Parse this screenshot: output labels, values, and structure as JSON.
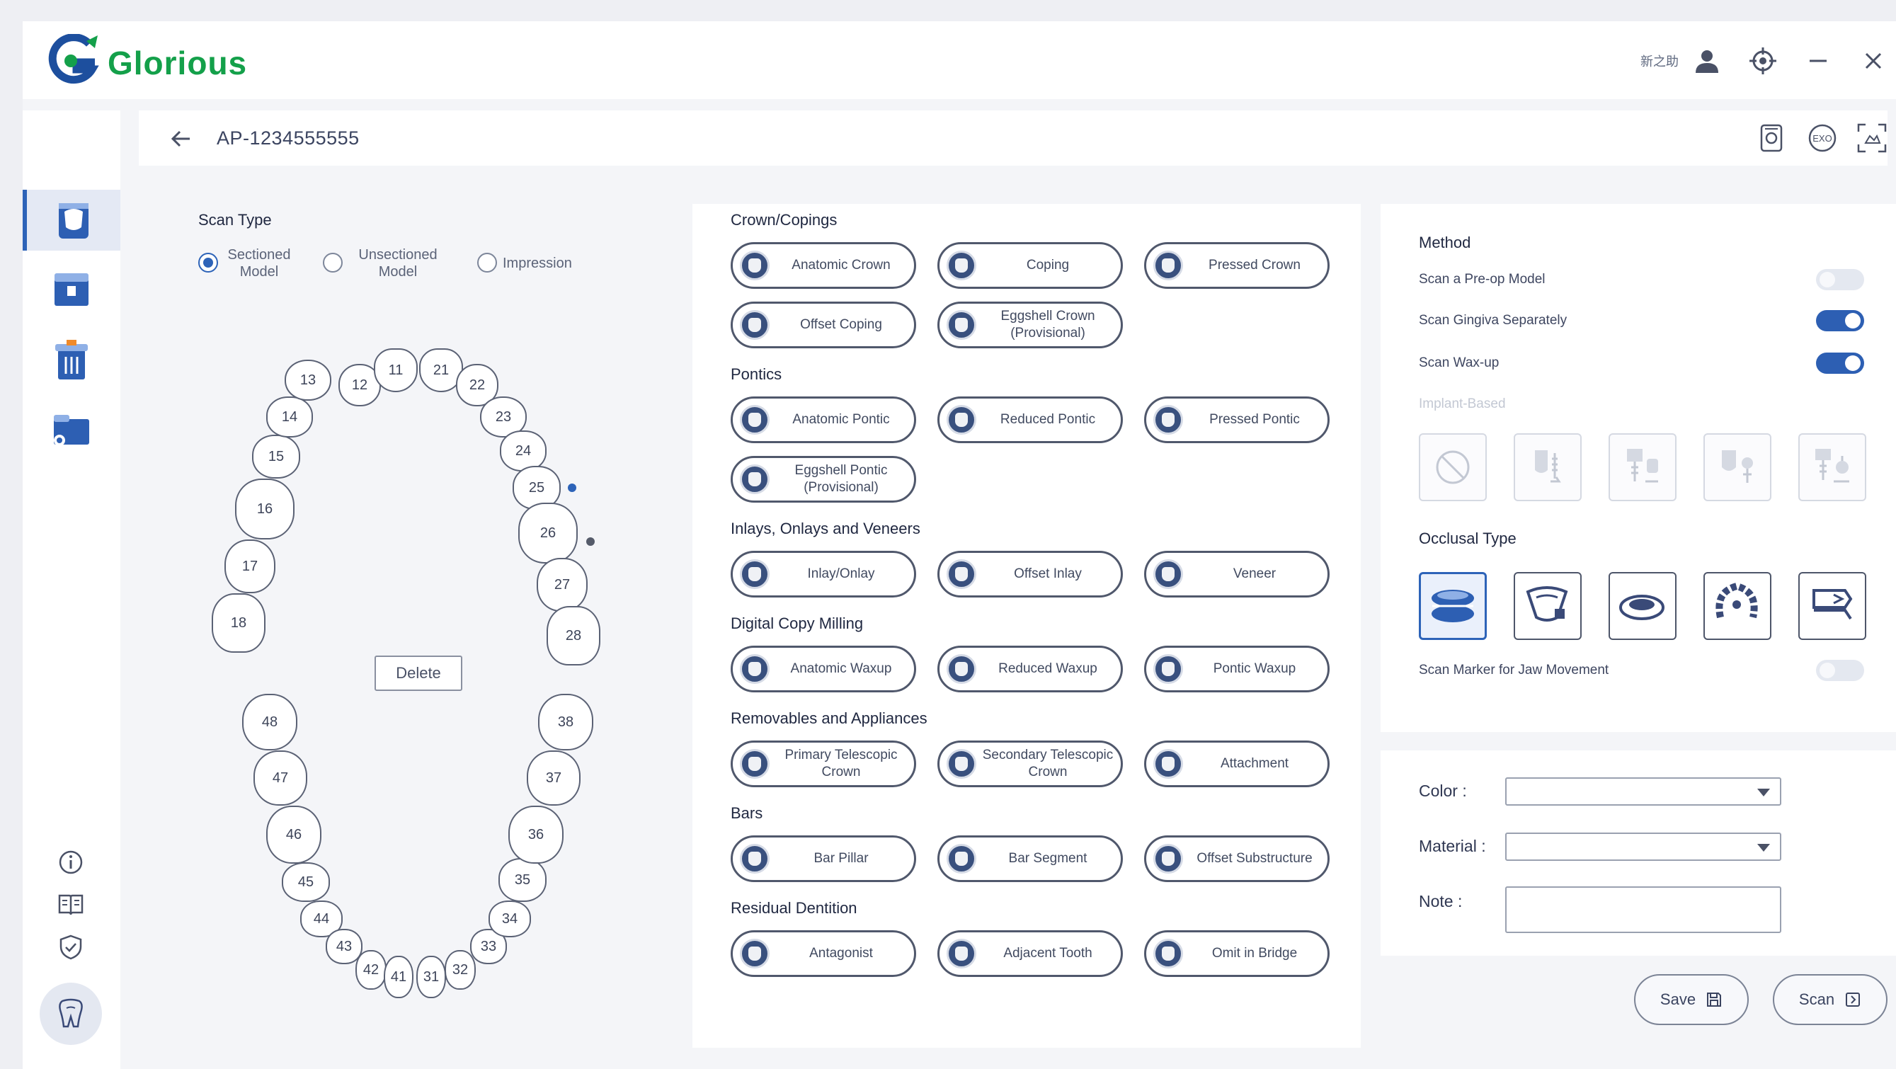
{
  "app": {
    "brand": "Glorious",
    "user_label": "新之助"
  },
  "breadcrumb": {
    "case_id": "AP-1234555555"
  },
  "scan_type": {
    "title": "Scan Type",
    "options": [
      {
        "label": "Sectioned Model",
        "checked": true
      },
      {
        "label": "Unsectioned Model",
        "checked": false
      },
      {
        "label": "Impression",
        "checked": false
      }
    ]
  },
  "teeth": {
    "upper": [
      "18",
      "17",
      "16",
      "15",
      "14",
      "13",
      "12",
      "11",
      "21",
      "22",
      "23",
      "24",
      "25",
      "26",
      "27",
      "28"
    ],
    "lower": [
      "48",
      "47",
      "46",
      "45",
      "44",
      "43",
      "42",
      "41",
      "31",
      "32",
      "33",
      "34",
      "35",
      "36",
      "37",
      "38"
    ],
    "delete_label": "Delete",
    "marker_colors": {
      "tooth25": "#2d63b8",
      "tooth26": "#555b6a"
    }
  },
  "categories": [
    {
      "title": "Crown/Copings",
      "items": [
        "Anatomic Crown",
        "Coping",
        "Pressed Crown",
        "Offset Coping",
        "Eggshell Crown (Provisional)"
      ]
    },
    {
      "title": "Pontics",
      "items": [
        "Anatomic Pontic",
        "Reduced Pontic",
        "Pressed Pontic",
        "Eggshell Pontic (Provisional)"
      ]
    },
    {
      "title": "Inlays, Onlays and Veneers",
      "items": [
        "Inlay/Onlay",
        "Offset Inlay",
        "Veneer"
      ]
    },
    {
      "title": "Digital Copy Milling",
      "items": [
        "Anatomic Waxup",
        "Reduced Waxup",
        "Pontic Waxup"
      ]
    },
    {
      "title": "Removables and Appliances",
      "items": [
        "Primary Telescopic Crown",
        "Secondary Telescopic Crown",
        "Attachment"
      ]
    },
    {
      "title": "Bars",
      "items": [
        "Bar Pillar",
        "Bar Segment",
        "Offset Substructure"
      ]
    },
    {
      "title": "Residual Dentition",
      "items": [
        "Antagonist",
        "Adjacent Tooth",
        "Omit in Bridge"
      ]
    }
  ],
  "method": {
    "title": "Method",
    "rows": [
      {
        "label": "Scan a Pre-op Model",
        "on": false
      },
      {
        "label": "Scan Gingiva Separately",
        "on": true
      },
      {
        "label": "Scan Wax-up",
        "on": true
      }
    ],
    "implant_label": "Implant-Based",
    "occlusal_title": "Occlusal Type",
    "jaw_marker_label": "Scan Marker for Jaw Movement",
    "jaw_marker_on": false
  },
  "form": {
    "color_label": "Color :",
    "material_label": "Material :",
    "note_label": "Note :",
    "color_value": "",
    "material_value": "",
    "note_value": ""
  },
  "actions": {
    "save_label": "Save",
    "scan_label": "Scan"
  },
  "colors": {
    "accent": "#2d63b8",
    "brand_green": "#14a04a",
    "brand_blue": "#1d4f9e"
  }
}
